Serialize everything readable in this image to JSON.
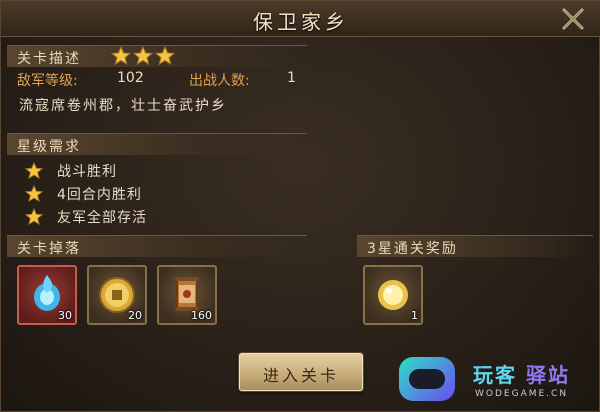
{
  "title": "保卫家乡",
  "level": {
    "header": "关卡描述",
    "stars": 3,
    "enemy_label": "敌军等级:",
    "enemy_value": "102",
    "troops_label": "出战人数:",
    "troops_value": "1",
    "description": "流寇席卷州郡，壮士奋武护乡"
  },
  "requirements": {
    "header": "星级需求",
    "items": [
      "战斗胜利",
      "4回合内胜利",
      "友军全部存活"
    ]
  },
  "drops": {
    "header": "关卡掉落",
    "items": [
      {
        "icon": "blue-gem-icon",
        "qty": "30"
      },
      {
        "icon": "gold-coin-icon",
        "qty": "20"
      },
      {
        "icon": "scroll-icon",
        "qty": "160"
      }
    ]
  },
  "reward": {
    "header": "3星通关奖励",
    "items": [
      {
        "icon": "gold-orb-icon",
        "qty": "1"
      }
    ]
  },
  "enter_button": "进入关卡",
  "watermark": {
    "text_a": "玩客",
    "text_b": "驿站",
    "sub": "WODEGAME.CN"
  },
  "colors": {
    "accent": "#e2a14a",
    "text": "#e8dcc3",
    "star": "#f5c542"
  }
}
